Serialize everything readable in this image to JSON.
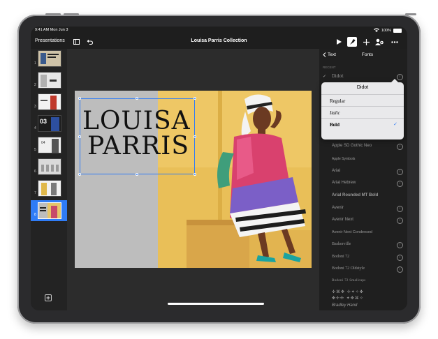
{
  "status": {
    "time_date": "9:41 AM  Mon Jun 3",
    "battery": "100%"
  },
  "toolbar": {
    "presentations_label": "Presentations",
    "doc_title": "Louisa Parris Collection"
  },
  "sidebar": {
    "slides": [
      {
        "num": "1"
      },
      {
        "num": "2"
      },
      {
        "num": "3"
      },
      {
        "num": "4"
      },
      {
        "num": "5"
      },
      {
        "num": "6"
      },
      {
        "num": "7"
      },
      {
        "num": "8"
      }
    ],
    "add_label": "+"
  },
  "slide": {
    "line1": "LOUISA",
    "line2": "PARRIS"
  },
  "panel": {
    "back_label": "Text",
    "title": "Fonts",
    "recent_header": "RECENT",
    "current_font": "Didot",
    "fonts": [
      "Apple SD Gothic Neo",
      "Apple Symbols",
      "Arial",
      "Arial Hebrew",
      "Arial Rounded MT Bold",
      "Avenir",
      "Avenir Next",
      "Avenir Next Condensed",
      "Baskerville",
      "Bodoni 72",
      "Bodoni 72 Oldstyle",
      "Bodoni 72 Smallcaps",
      "Bradley Hand"
    ]
  },
  "popover": {
    "title": "Didot",
    "styles": [
      "Regular",
      "Italic",
      "Bold"
    ],
    "selected": "Bold"
  },
  "colors": {
    "accent": "#2f7cf6",
    "background": "#1e1e1e",
    "panel": "#1f1f1f"
  }
}
